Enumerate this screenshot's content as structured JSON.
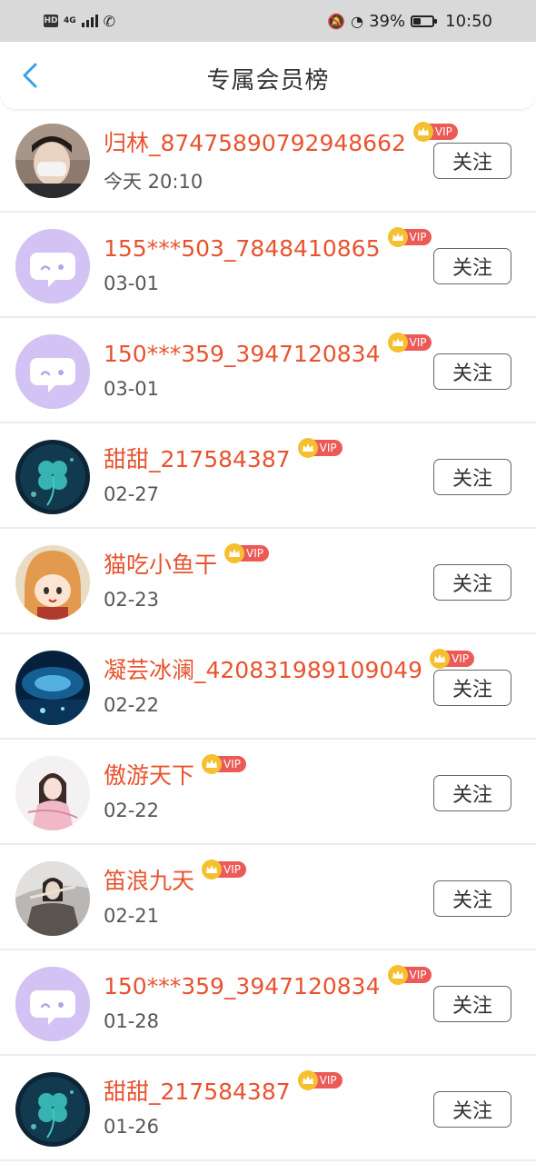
{
  "status_bar": {
    "hd": "HD",
    "network": "4G",
    "battery": "39%",
    "battery_level": 0.39,
    "time": "10:50"
  },
  "header": {
    "title": "专属会员榜",
    "back_icon": "chevron-left-icon",
    "accent_color": "#3aa0e6"
  },
  "colors": {
    "name": "#e8532f",
    "vip_crown": "#f5c02f",
    "vip_badge": "#ec5a57",
    "default_avatar": "#d3c2f4"
  },
  "vip_label": "VIP",
  "members": [
    {
      "name": "归林_87475890792948662",
      "time": "今天 20:10",
      "follow": "关注",
      "avatar": "photo-boy-mask"
    },
    {
      "name": "155***503_7848410865",
      "time": "03-01",
      "follow": "关注",
      "avatar": "default-chat-avatar"
    },
    {
      "name": "150***359_3947120834",
      "time": "03-01",
      "follow": "关注",
      "avatar": "default-chat-avatar"
    },
    {
      "name": "甜甜_217584387",
      "time": "02-27",
      "follow": "关注",
      "avatar": "clover-night"
    },
    {
      "name": "猫吃小鱼干",
      "time": "02-23",
      "follow": "关注",
      "avatar": "anime-girl"
    },
    {
      "name": "凝芸冰澜_420831989109049",
      "time": "02-22",
      "follow": "关注",
      "avatar": "blue-night-scene"
    },
    {
      "name": "傲游天下",
      "time": "02-22",
      "follow": "关注",
      "avatar": "pink-lady"
    },
    {
      "name": "笛浪九天",
      "time": "02-21",
      "follow": "关注",
      "avatar": "flute-player"
    },
    {
      "name": "150***359_3947120834",
      "time": "01-28",
      "follow": "关注",
      "avatar": "default-chat-avatar"
    },
    {
      "name": "甜甜_217584387",
      "time": "01-26",
      "follow": "关注",
      "avatar": "clover-night"
    }
  ]
}
